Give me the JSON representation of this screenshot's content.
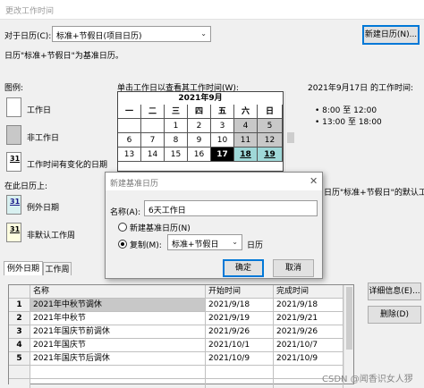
{
  "window": {
    "title": "更改工作时间"
  },
  "for_calendar": {
    "label": "对于日历(C):",
    "value": "标准+节假日(项目日历)"
  },
  "new_calendar_button": "新建日历(N)...",
  "base_calendar_note": "日历\"标准+节假日\"为基准日历。",
  "legend": {
    "title": "图例:",
    "working": "工作日",
    "nonworking": "非工作日",
    "changed_hours": "工作时间有变化的日期",
    "changed_num": "31",
    "on_this_calendar": "在此日历上:",
    "exception_num": "31",
    "exception": "例外日期",
    "nondefault_num": "31",
    "nondefault": "非默认工作周"
  },
  "calendar_prompt": "单击工作日以查看其工作时间(W):",
  "calendar": {
    "month": "2021年9月",
    "weekdays": [
      "一",
      "二",
      "三",
      "四",
      "五",
      "六",
      "日"
    ],
    "row1": [
      "",
      "",
      "1",
      "2",
      "3",
      "4",
      "5"
    ],
    "row2": [
      "6",
      "7",
      "8",
      "9",
      "10",
      "11",
      "12"
    ],
    "row3": [
      "13",
      "14",
      "15",
      "16",
      "17",
      "18",
      "19"
    ]
  },
  "working_times": {
    "title": "2021年9月17日 的工作时间:",
    "slot1": "8:00 至 12:00",
    "slot2": "13:00 至 18:00"
  },
  "partial_text": "日历\"标准+节假日\"的默认工作",
  "dialog": {
    "title": "新建基准日历",
    "name_label": "名称(A):",
    "name_value": "6天工作日",
    "opt_new": "新建基准日历(N)",
    "opt_copy": "复制(M):",
    "copy_value": "标准+节假日",
    "calendar_suffix": "日历",
    "ok": "确定",
    "cancel": "取消"
  },
  "tabs": {
    "exceptions": "例外日期",
    "workweeks": "工作周"
  },
  "table": {
    "headers": {
      "name": "名称",
      "start": "开始时间",
      "finish": "完成时间"
    },
    "rows": [
      {
        "n": "1",
        "name": "2021年中秋节调休",
        "start": "2021/9/18",
        "finish": "2021/9/18"
      },
      {
        "n": "2",
        "name": "2021年中秋节",
        "start": "2021/9/19",
        "finish": "2021/9/21"
      },
      {
        "n": "3",
        "name": "2021年国庆节前调休",
        "start": "2021/9/26",
        "finish": "2021/9/26"
      },
      {
        "n": "4",
        "name": "2021年国庆节",
        "start": "2021/10/1",
        "finish": "2021/10/7"
      },
      {
        "n": "5",
        "name": "2021年国庆节后调休",
        "start": "2021/10/9",
        "finish": "2021/10/9"
      }
    ]
  },
  "details_button": "详细信息(E)...",
  "delete_button": "删除(D)",
  "watermark": "CSDN @闻香识女人猡"
}
